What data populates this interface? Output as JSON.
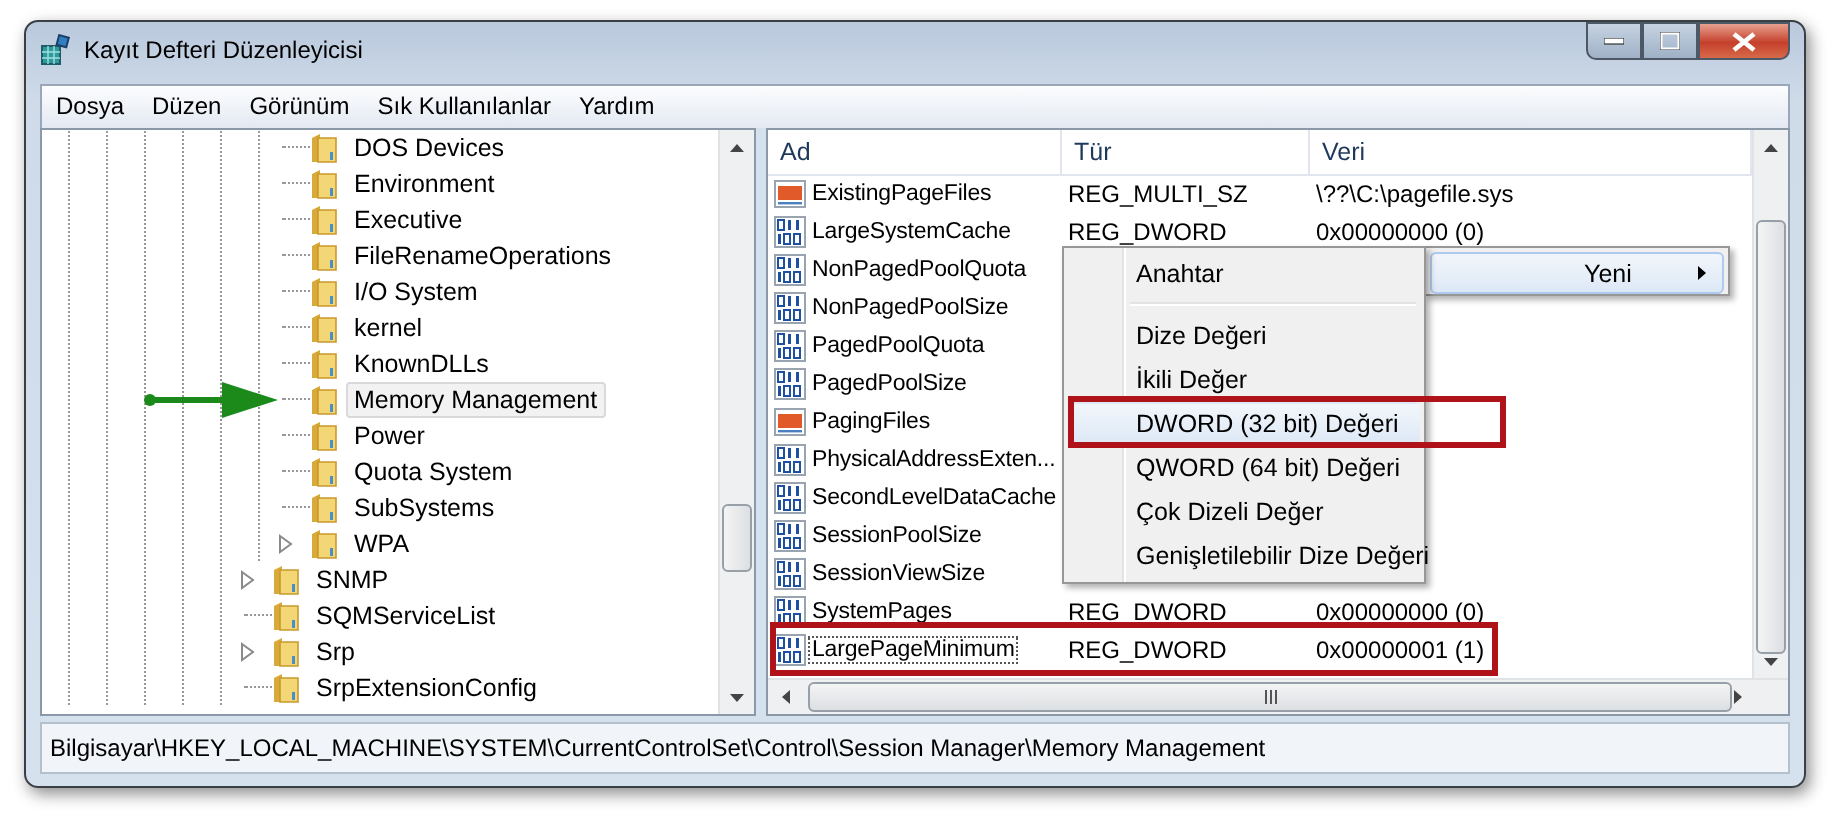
{
  "window": {
    "title": "Kayıt Defteri Düzenleyicisi"
  },
  "menu_bar": [
    "Dosya",
    "Düzen",
    "Görünüm",
    "Sık Kullanılanlar",
    "Yardım"
  ],
  "tree": {
    "items": [
      {
        "children": [
          {
            "label": "DOS Devices",
            "expandable": false,
            "selected": false,
            "pointed": false
          },
          {
            "label": "Environment",
            "expandable": false,
            "selected": false,
            "pointed": false
          },
          {
            "label": "Executive",
            "expandable": false,
            "selected": false,
            "pointed": false
          },
          {
            "label": "FileRenameOperations",
            "expandable": false,
            "selected": false,
            "pointed": false
          },
          {
            "label": "I/O System",
            "expandable": false,
            "selected": false,
            "pointed": false
          },
          {
            "label": "kernel",
            "expandable": false,
            "selected": false,
            "pointed": false
          },
          {
            "label": "KnownDLLs",
            "expandable": false,
            "selected": false,
            "pointed": false
          },
          {
            "label": "Memory Management",
            "expandable": false,
            "selected": true,
            "pointed": true
          },
          {
            "label": "Power",
            "expandable": false,
            "selected": false,
            "pointed": false
          },
          {
            "label": "Quota System",
            "expandable": false,
            "selected": false,
            "pointed": false
          },
          {
            "label": "SubSystems",
            "expandable": false,
            "selected": false,
            "pointed": false
          },
          {
            "label": "WPA",
            "expandable": true,
            "selected": false,
            "pointed": false
          }
        ]
      },
      {
        "label": "SNMP",
        "expandable": true,
        "selected": false,
        "pointed": false
      },
      {
        "label": "SQMServiceList",
        "expandable": false,
        "selected": false,
        "pointed": false
      },
      {
        "label": "Srp",
        "expandable": true,
        "selected": false,
        "pointed": false
      },
      {
        "label": "SrpExtensionConfig",
        "expandable": false,
        "selected": false,
        "pointed": false
      }
    ]
  },
  "table": {
    "columns": [
      "Ad",
      "Tür",
      "Veri"
    ],
    "rows": [
      {
        "kind": "string",
        "name": "ExistingPageFiles",
        "type": "REG_MULTI_SZ",
        "data": "\\??\\C:\\pagefile.sys",
        "focused": false,
        "annotated": false
      },
      {
        "kind": "binary",
        "name": "LargeSystemCache",
        "type": "REG_DWORD",
        "data": "0x00000000 (0)",
        "focused": false,
        "annotated": false
      },
      {
        "kind": "binary",
        "name": "NonPagedPoolQuota",
        "focused": false,
        "annotated": false
      },
      {
        "kind": "binary",
        "name": "NonPagedPoolSize",
        "focused": false,
        "annotated": false
      },
      {
        "kind": "binary",
        "name": "PagedPoolQuota",
        "focused": false,
        "annotated": false
      },
      {
        "kind": "binary",
        "name": "PagedPoolSize",
        "focused": false,
        "annotated": false
      },
      {
        "kind": "string",
        "name": "PagingFiles",
        "focused": false,
        "annotated": false
      },
      {
        "kind": "binary",
        "name": "PhysicalAddressExten...",
        "focused": false,
        "annotated": false
      },
      {
        "kind": "binary",
        "name": "SecondLevelDataCache",
        "focused": false,
        "annotated": false
      },
      {
        "kind": "binary",
        "name": "SessionPoolSize",
        "focused": false,
        "annotated": false
      },
      {
        "kind": "binary",
        "name": "SessionViewSize",
        "focused": false,
        "annotated": false
      },
      {
        "kind": "binary",
        "name": "SystemPages",
        "type": "REG_DWORD",
        "data": "0x00000000 (0)",
        "focused": false,
        "annotated": false
      },
      {
        "kind": "binary",
        "name": "LargePageMinimum",
        "type": "REG_DWORD",
        "data": "0x00000001 (1)",
        "focused": true,
        "annotated": true
      }
    ]
  },
  "context_menu": {
    "parent_item": {
      "label": "Yeni",
      "highlighted": true
    },
    "submenu": [
      {
        "kind": "item",
        "label": "Anahtar",
        "highlighted": false,
        "annotated": false
      },
      {
        "kind": "separator"
      },
      {
        "kind": "item",
        "label": "Dize Değeri",
        "highlighted": false,
        "annotated": false
      },
      {
        "kind": "item",
        "label": "İkili Değer",
        "highlighted": false,
        "annotated": false
      },
      {
        "kind": "item",
        "label": "DWORD (32 bit) Değeri",
        "highlighted": true,
        "annotated": true
      },
      {
        "kind": "item",
        "label": "QWORD (64 bit) Değeri",
        "highlighted": false,
        "annotated": false
      },
      {
        "kind": "item",
        "label": "Çok Dizeli Değer",
        "highlighted": false,
        "annotated": false
      },
      {
        "kind": "item",
        "label": "Genişletilebilir Dize Değeri",
        "highlighted": false,
        "annotated": false
      }
    ]
  },
  "status_bar": "Bilgisayar\\HKEY_LOCAL_MACHINE\\SYSTEM\\CurrentControlSet\\Control\\Session Manager\\Memory Management"
}
